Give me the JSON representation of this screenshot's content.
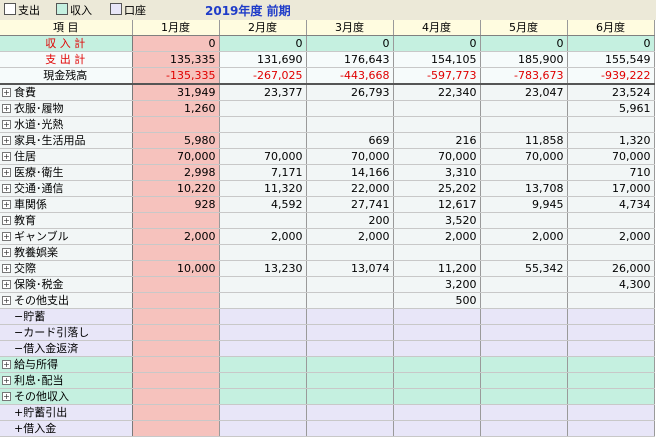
{
  "toolbar": {
    "checkboxes": [
      "支出",
      "収入",
      "口座"
    ],
    "title": "2019年度 前期"
  },
  "header": {
    "item": "項 目",
    "months": [
      "1月度",
      "2月度",
      "3月度",
      "4月度",
      "5月度",
      "6月度"
    ]
  },
  "colors": {
    "income_row": "#c5f0e0",
    "expense_row": "#f2f6f6",
    "jan_col": "#f6c2bd",
    "lavender": "#e8e6f8",
    "negative": "#e00000",
    "title": "#1f3cc9"
  },
  "summary": [
    {
      "label": "収 入 計",
      "values": [
        "0",
        "0",
        "0",
        "0",
        "0",
        "0"
      ]
    },
    {
      "label": "支 出 計",
      "values": [
        "135,335",
        "131,690",
        "176,643",
        "154,105",
        "185,900",
        "155,549"
      ]
    },
    {
      "label": "現金残高",
      "values": [
        "-135,335",
        "-267,025",
        "-443,668",
        "-597,773",
        "-783,673",
        "-939,222"
      ]
    }
  ],
  "rows": [
    {
      "label": "食費",
      "expand": true,
      "values": [
        "31,949",
        "23,377",
        "26,793",
        "22,340",
        "23,047",
        "23,524"
      ]
    },
    {
      "label": "衣服･履物",
      "expand": true,
      "values": [
        "1,260",
        "",
        "",
        "",
        "",
        "5,961"
      ]
    },
    {
      "label": "水道･光熱",
      "expand": true,
      "values": [
        "",
        "",
        "",
        "",
        "",
        ""
      ]
    },
    {
      "label": "家具･生活用品",
      "expand": true,
      "values": [
        "5,980",
        "",
        "669",
        "216",
        "11,858",
        "1,320"
      ]
    },
    {
      "label": "住居",
      "expand": true,
      "values": [
        "70,000",
        "70,000",
        "70,000",
        "70,000",
        "70,000",
        "70,000"
      ]
    },
    {
      "label": "医療･衛生",
      "expand": true,
      "values": [
        "2,998",
        "7,171",
        "14,166",
        "3,310",
        "",
        "710"
      ]
    },
    {
      "label": "交通･通信",
      "expand": true,
      "values": [
        "10,220",
        "11,320",
        "22,000",
        "25,202",
        "13,708",
        "17,000"
      ]
    },
    {
      "label": "車関係",
      "expand": true,
      "values": [
        "928",
        "4,592",
        "27,741",
        "12,617",
        "9,945",
        "4,734"
      ]
    },
    {
      "label": "教育",
      "expand": true,
      "values": [
        "",
        "",
        "200",
        "3,520",
        "",
        ""
      ]
    },
    {
      "label": "ギャンブル",
      "expand": true,
      "values": [
        "2,000",
        "2,000",
        "2,000",
        "2,000",
        "2,000",
        "2,000"
      ]
    },
    {
      "label": "教養娯楽",
      "expand": true,
      "values": [
        "",
        "",
        "",
        "",
        "",
        ""
      ]
    },
    {
      "label": "交際",
      "expand": true,
      "values": [
        "10,000",
        "13,230",
        "13,074",
        "11,200",
        "55,342",
        "26,000"
      ]
    },
    {
      "label": "保険･税金",
      "expand": true,
      "values": [
        "",
        "",
        "",
        "3,200",
        "",
        "4,300"
      ]
    },
    {
      "label": "その他支出",
      "expand": true,
      "values": [
        "",
        "",
        "",
        "500",
        "",
        ""
      ]
    },
    {
      "label": "−貯蓄",
      "expand": false,
      "values": [
        "",
        "",
        "",
        "",
        "",
        ""
      ]
    },
    {
      "label": "−カード引落し",
      "expand": false,
      "values": [
        "",
        "",
        "",
        "",
        "",
        ""
      ]
    },
    {
      "label": "−借入金返済",
      "expand": false,
      "values": [
        "",
        "",
        "",
        "",
        "",
        ""
      ]
    },
    {
      "label": "給与所得",
      "expand": true,
      "values": [
        "",
        "",
        "",
        "",
        "",
        ""
      ]
    },
    {
      "label": "利息･配当",
      "expand": true,
      "values": [
        "",
        "",
        "",
        "",
        "",
        ""
      ]
    },
    {
      "label": "その他収入",
      "expand": true,
      "values": [
        "",
        "",
        "",
        "",
        "",
        ""
      ]
    },
    {
      "label": "+貯蓄引出",
      "expand": false,
      "values": [
        "",
        "",
        "",
        "",
        "",
        ""
      ]
    },
    {
      "label": "+借入金",
      "expand": false,
      "values": [
        "",
        "",
        "",
        "",
        "",
        ""
      ]
    }
  ]
}
